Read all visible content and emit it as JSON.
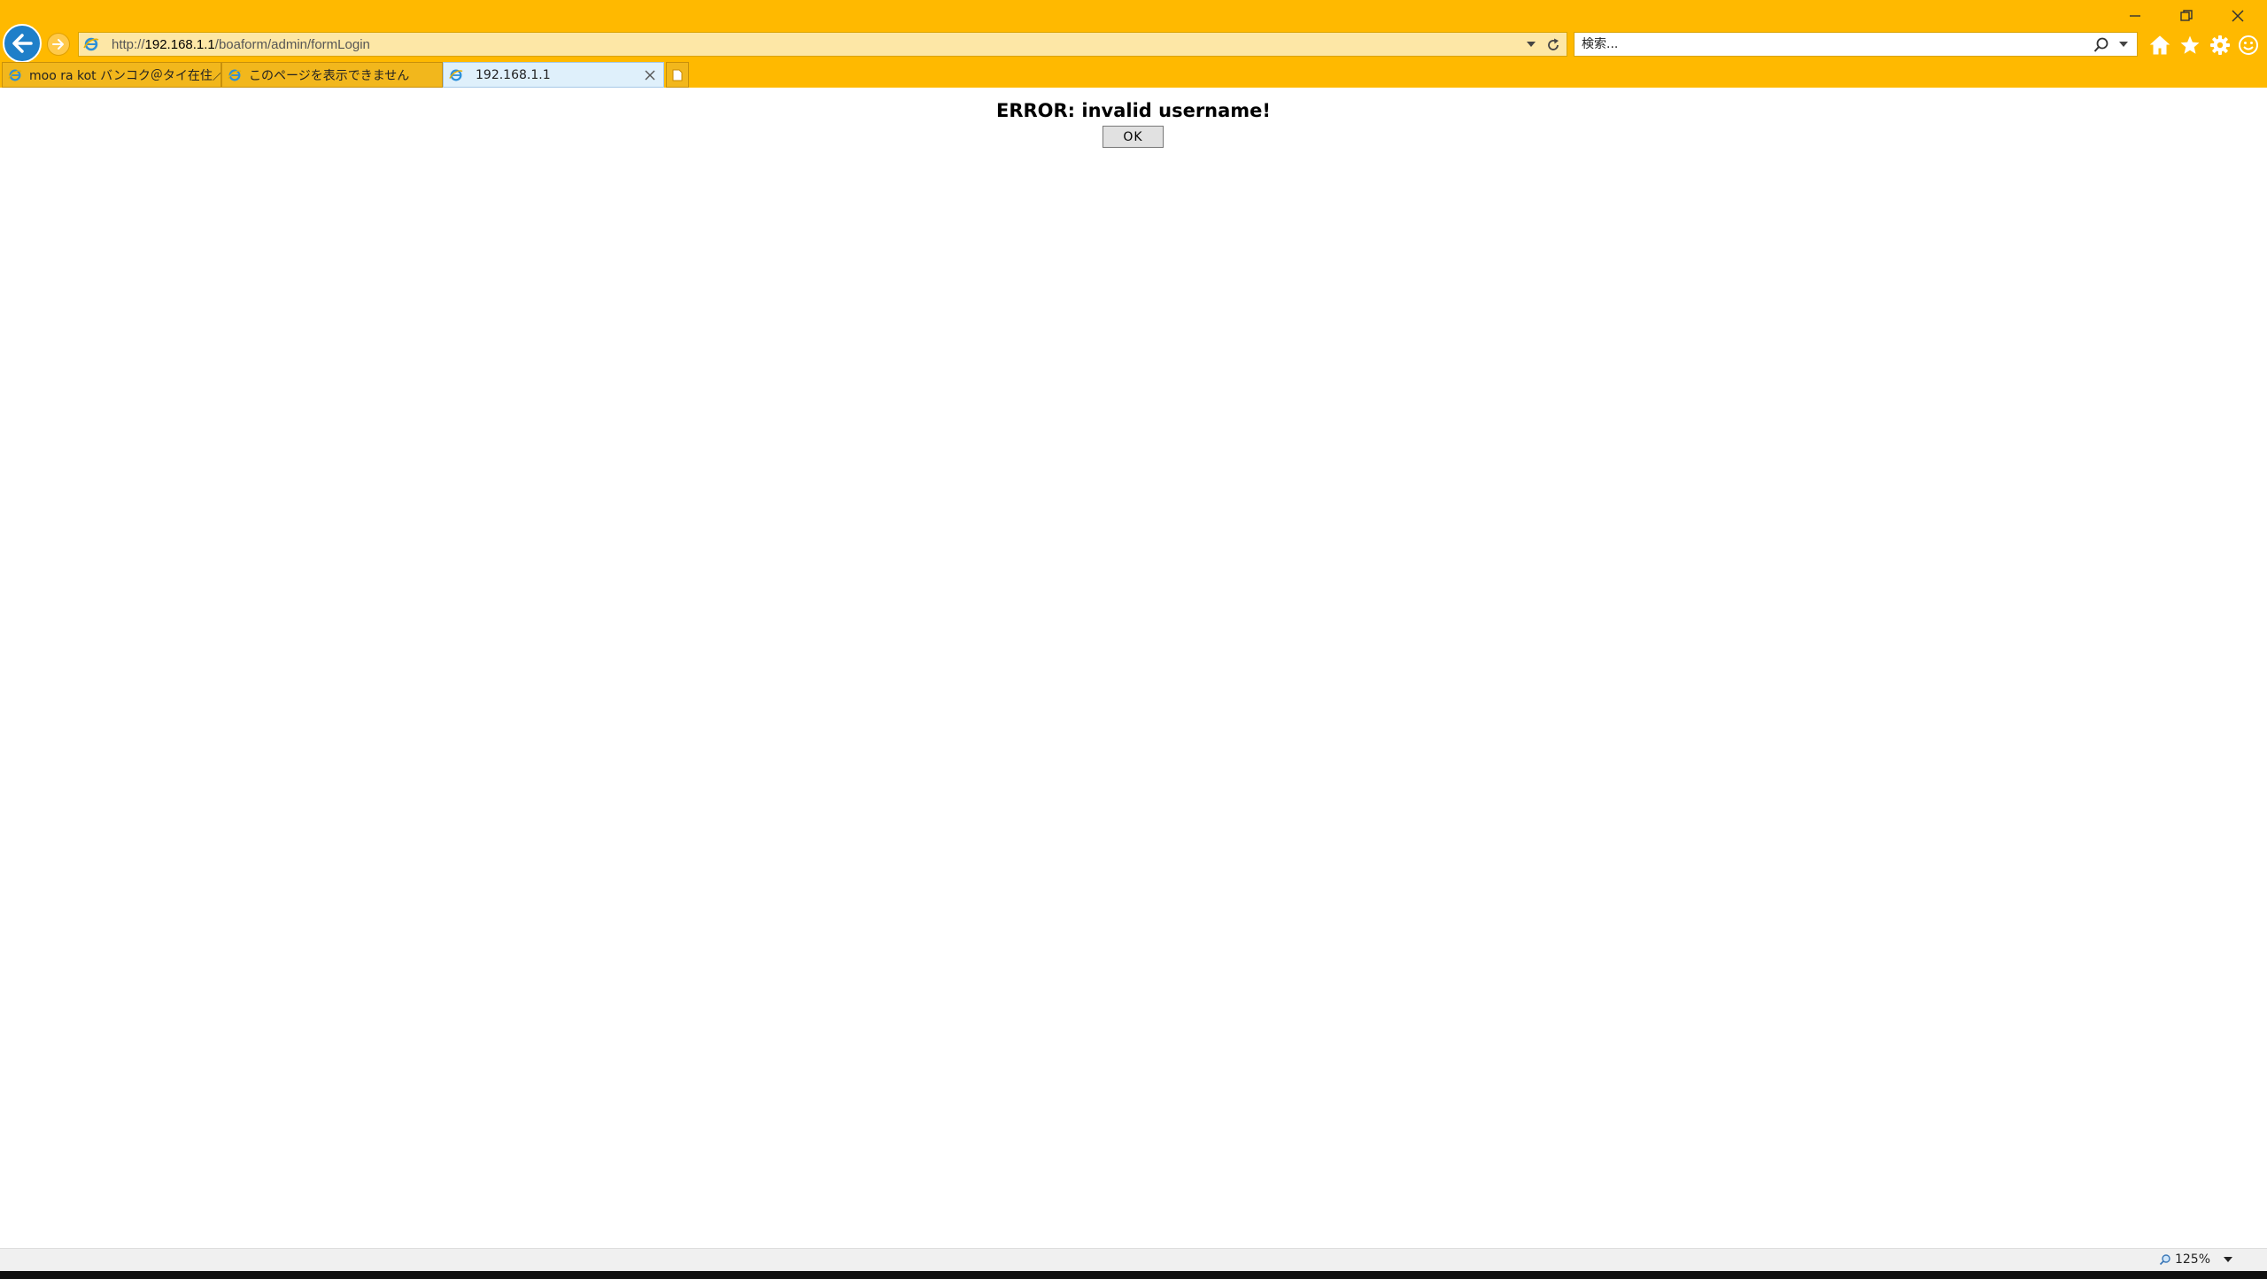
{
  "window": {
    "minimize_icon": "minimize-icon",
    "restore_icon": "restore-icon",
    "close_icon": "close-icon"
  },
  "nav": {
    "back_icon": "back-arrow-icon",
    "forward_icon": "forward-arrow-icon"
  },
  "address": {
    "scheme": "http://",
    "host": "192.168.1.1",
    "path": "/boaform/admin/formLogin"
  },
  "search": {
    "placeholder": "検索..."
  },
  "toolbar": {
    "icons": [
      "home-icon",
      "favorites-star-icon",
      "settings-gear-icon",
      "smiley-feedback-icon"
    ]
  },
  "tabs": [
    {
      "label": "moo ra kot バンコク＠タイ在住／...",
      "active": false
    },
    {
      "label": "このページを表示できません",
      "active": false
    },
    {
      "label": "192.168.1.1",
      "active": true
    }
  ],
  "content": {
    "error_message": "ERROR: invalid username!",
    "ok_label": "OK"
  },
  "status": {
    "zoom": "125%"
  },
  "colors": {
    "chrome": "#ffb900",
    "back_button": "#1f7fc9",
    "active_tab": "#dff0fb"
  }
}
